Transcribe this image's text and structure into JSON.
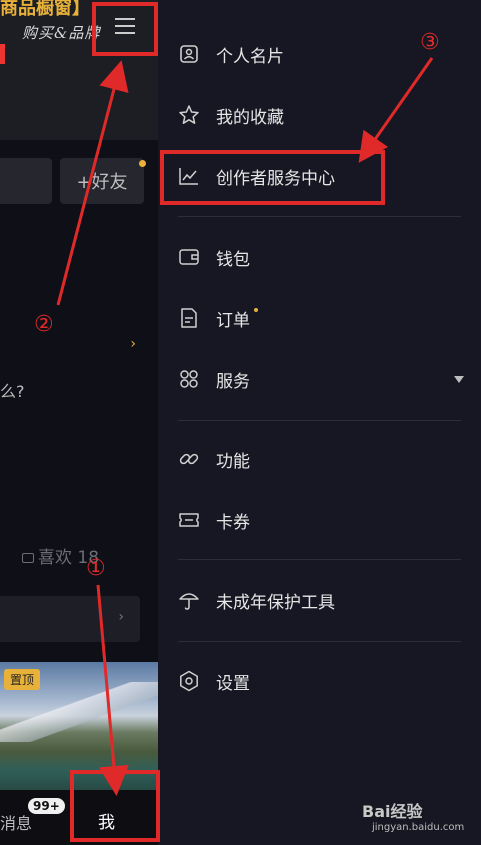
{
  "left": {
    "banner_title": "商品橱窗】",
    "banner_cursive": "购买&品牌",
    "friend_btn": "+好友",
    "question": "么?",
    "likes": "喜欢 18",
    "pin_label": "置顶",
    "tab_msg": "消息",
    "tab_badge": "99+",
    "tab_me": "我"
  },
  "menu": {
    "items": [
      {
        "label": "个人名片",
        "icon": "id-card-icon"
      },
      {
        "label": "我的收藏",
        "icon": "star-icon"
      },
      {
        "label": "创作者服务中心",
        "icon": "chart-line-icon"
      },
      {
        "label": "钱包",
        "icon": "wallet-icon"
      },
      {
        "label": "订单",
        "icon": "document-icon"
      },
      {
        "label": "服务",
        "icon": "grid-icon"
      },
      {
        "label": "功能",
        "icon": "link-icon"
      },
      {
        "label": "卡券",
        "icon": "ticket-icon"
      },
      {
        "label": "未成年保护工具",
        "icon": "umbrella-icon"
      },
      {
        "label": "设置",
        "icon": "gear-icon"
      }
    ]
  },
  "annotations": {
    "a1": "①",
    "a2": "②",
    "a3": "③"
  },
  "watermark": {
    "brand": "Bai经验",
    "url": "jingyan.baidu.com"
  },
  "colors": {
    "accent": "#e8b23a",
    "annotation": "#e02929",
    "panel_bg": "#161722"
  }
}
